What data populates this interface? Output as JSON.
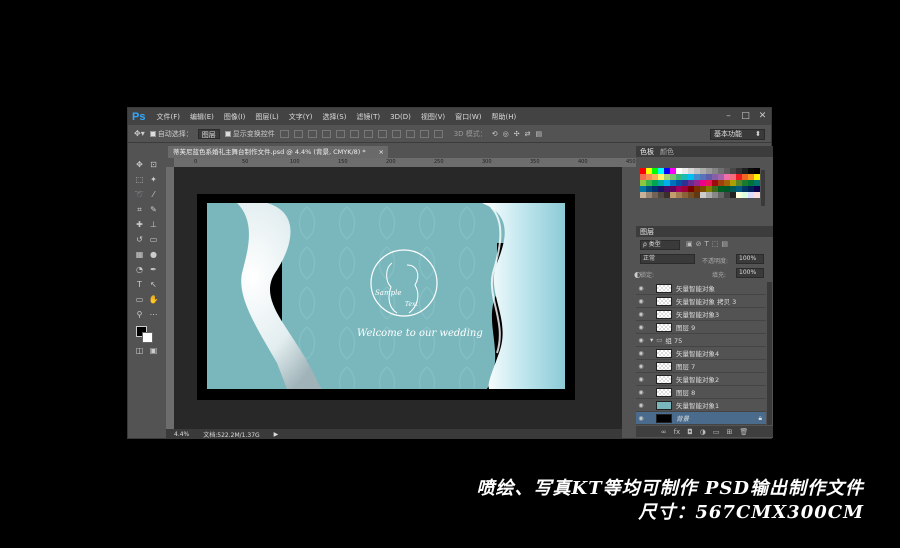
{
  "app": {
    "logo": "Ps"
  },
  "menu": [
    "文件(F)",
    "编辑(E)",
    "图像(I)",
    "图层(L)",
    "文字(Y)",
    "选择(S)",
    "滤镜(T)",
    "3D(D)",
    "视图(V)",
    "窗口(W)",
    "帮助(H)"
  ],
  "window_controls": {
    "minimize": "–",
    "restore": "□",
    "close": "✕"
  },
  "options": {
    "auto_select_label": "自动选择：",
    "auto_select_value": "图层",
    "transform_label": "显示变换控件",
    "mode_3d": "3D 模式：",
    "workspace": "基本功能"
  },
  "document": {
    "tab_title": "蒂芙尼蓝色系婚礼主舞台制作文件.psd @ 4.4% (背景, CMYK/8) *",
    "close": "×"
  },
  "ruler": {
    "h_ticks": [
      "0",
      "50",
      "100",
      "150",
      "200",
      "250",
      "300",
      "350",
      "400",
      "450",
      "500",
      "550"
    ]
  },
  "design": {
    "welcome": "Welcome to our wedding",
    "sample": "Sample",
    "text": "Text",
    "ring_text": "Welcome to our wedding"
  },
  "status": {
    "zoom": "4.4%",
    "doc": "文档:522.2M/1.37G"
  },
  "panels": {
    "color_tabs": [
      "色板",
      "颜色"
    ],
    "layers_tab": "图层",
    "kind_label": "ρ 类型",
    "blend_mode": "正常",
    "opacity_label": "不透明度:",
    "opacity_value": "100%",
    "lock_label": "锁定:",
    "fill_label": "填充:",
    "fill_value": "100%",
    "layers": [
      {
        "name": "矢量智能对象",
        "group": false
      },
      {
        "name": "矢量智能对象 拷贝 3",
        "group": false
      },
      {
        "name": "矢量智能对象3",
        "group": false
      },
      {
        "name": "图层 9",
        "group": false
      },
      {
        "name": "组 75",
        "group": true
      },
      {
        "name": "矢量智能对象4",
        "group": false
      },
      {
        "name": "图层 7",
        "group": false
      },
      {
        "name": "矢量智能对象2",
        "group": false
      },
      {
        "name": "图层 8",
        "group": false
      },
      {
        "name": "矢量智能对象1",
        "group": false
      },
      {
        "name": "背景",
        "group": false,
        "selected": true
      }
    ]
  },
  "captions": {
    "line1": "喷绘、写真KT等均可制作  PSD输出制作文件",
    "line2": "尺寸：567CMX300CM"
  },
  "colors": {
    "tiffany": "#79b7bd",
    "ps_blue": "#31a8ff",
    "selected_layer": "#4a6b8c"
  }
}
